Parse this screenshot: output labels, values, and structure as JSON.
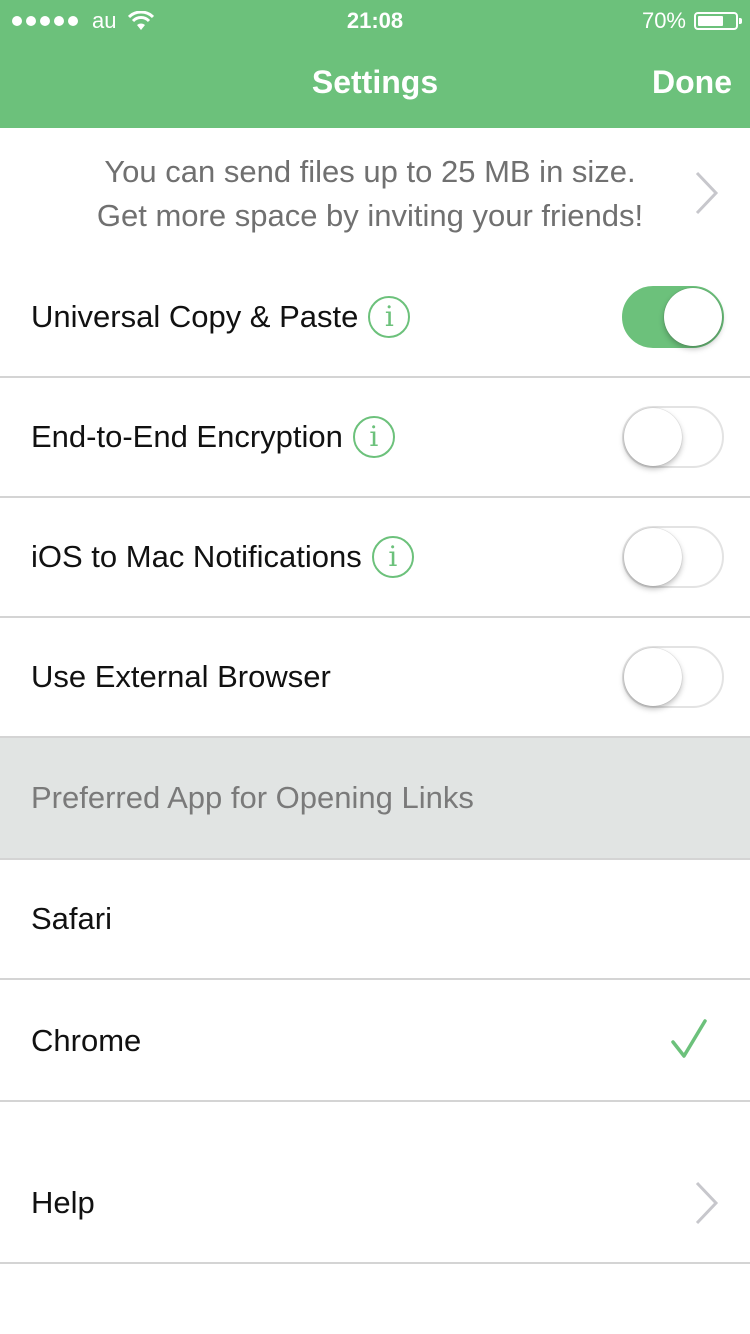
{
  "status_bar": {
    "carrier": "au",
    "time": "21:08",
    "battery": "70%",
    "battery_level": 0.7
  },
  "nav": {
    "title": "Settings",
    "done": "Done"
  },
  "promo": {
    "line1": "You can send files up to 25 MB in size.",
    "line2": "Get more space by inviting your friends!"
  },
  "toggles": [
    {
      "label": "Universal Copy & Paste",
      "info": "i",
      "on": true
    },
    {
      "label": "End-to-End Encryption",
      "info": "i",
      "on": false
    },
    {
      "label": "iOS to Mac Notifications",
      "info": "i",
      "on": false
    },
    {
      "label": "Use External Browser",
      "on": false
    }
  ],
  "section": {
    "header": "Preferred App for Opening Links",
    "options": [
      {
        "label": "Safari",
        "selected": false
      },
      {
        "label": "Chrome",
        "selected": true
      }
    ]
  },
  "help": {
    "label": "Help"
  },
  "colors": {
    "accent": "#6cc17b",
    "section_bg": "#e1e4e3",
    "divider": "#d4d4d4"
  },
  "icons": [
    "signal-dots-icon",
    "wifi-icon",
    "battery-icon",
    "info-icon",
    "chevron-right-icon",
    "checkmark-icon"
  ]
}
